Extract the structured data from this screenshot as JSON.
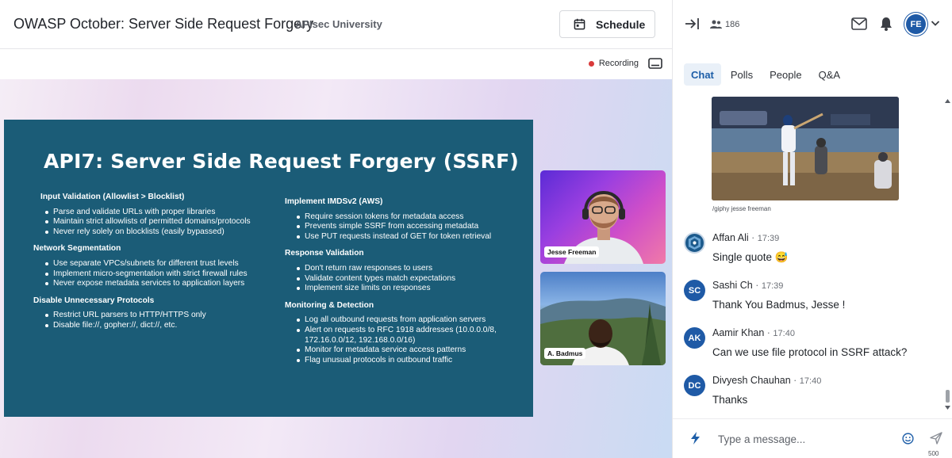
{
  "header": {
    "event_title": "OWASP October: Server Side Request Forgery",
    "org_name": "APIsec University",
    "schedule_label": "Schedule"
  },
  "stage": {
    "recording_label": "Recording",
    "slide": {
      "title": "API7: Server Side Request Forgery (SSRF)",
      "left_sections": [
        {
          "heading": "Input Validation (Allowlist > Blocklist)",
          "items": [
            "Parse and validate URLs with proper libraries",
            "Maintain strict allowlists of permitted domains/protocols",
            "Never rely solely on blocklists (easily bypassed)"
          ]
        },
        {
          "heading": "Network Segmentation",
          "items": [
            "Use separate VPCs/subnets for different trust levels",
            "Implement micro-segmentation with strict firewall rules",
            "Never expose metadata services to application layers"
          ]
        },
        {
          "heading": "Disable Unnecessary Protocols",
          "items": [
            "Restrict URL parsers to HTTP/HTTPS only",
            "Disable file://, gopher://, dict://, etc."
          ]
        }
      ],
      "right_sections": [
        {
          "heading": "Implement IMDSv2 (AWS)",
          "items": [
            "Require session tokens for metadata access",
            "Prevents simple SSRF from accessing metadata",
            "Use PUT requests instead of GET for token retrieval"
          ]
        },
        {
          "heading": "Response Validation",
          "items": [
            "Don't return raw responses to users",
            "Validate content types match expectations",
            "Implement size limits on responses"
          ]
        },
        {
          "heading": "Monitoring & Detection",
          "items": [
            "Log all outbound requests from application servers",
            "Alert on requests to RFC 1918 addresses (10.0.0.0/8, 172.16.0.0/12, 192.168.0.0/16)",
            "Monitor for metadata service access patterns",
            "Flag unusual protocols in outbound traffic"
          ]
        }
      ]
    },
    "tiles": [
      {
        "name": "Jesse Freeman"
      },
      {
        "name": "A. Badmus"
      }
    ]
  },
  "panel": {
    "attendee_count": "186",
    "avatar_initials": "FE",
    "tabs": [
      "Chat",
      "Polls",
      "People",
      "Q&A"
    ],
    "gif_caption": "/giphy jesse freeman",
    "messages": [
      {
        "initials": "",
        "author": "Affan Ali",
        "time": "17:39",
        "text": "Single quote 😅",
        "color": "#1c5a8c"
      },
      {
        "initials": "SC",
        "author": "Sashi Ch",
        "time": "17:39",
        "text": "Thank You Badmus, Jesse !",
        "color": "#1f5aa6"
      },
      {
        "initials": "AK",
        "author": "Aamir Khan",
        "time": "17:40",
        "text": "Can we use file protocol in SSRF attack?",
        "color": "#1f5aa6"
      },
      {
        "initials": "DC",
        "author": "Divyesh Chauhan",
        "time": "17:40",
        "text": "Thanks",
        "color": "#1f5aa6"
      }
    ],
    "composer": {
      "placeholder": "Type a message...",
      "char_limit": "500"
    }
  },
  "colors": {
    "accent": "#1d5ea8",
    "slide_bg": "#1b5c77",
    "recording_dot": "#d93a3a"
  }
}
